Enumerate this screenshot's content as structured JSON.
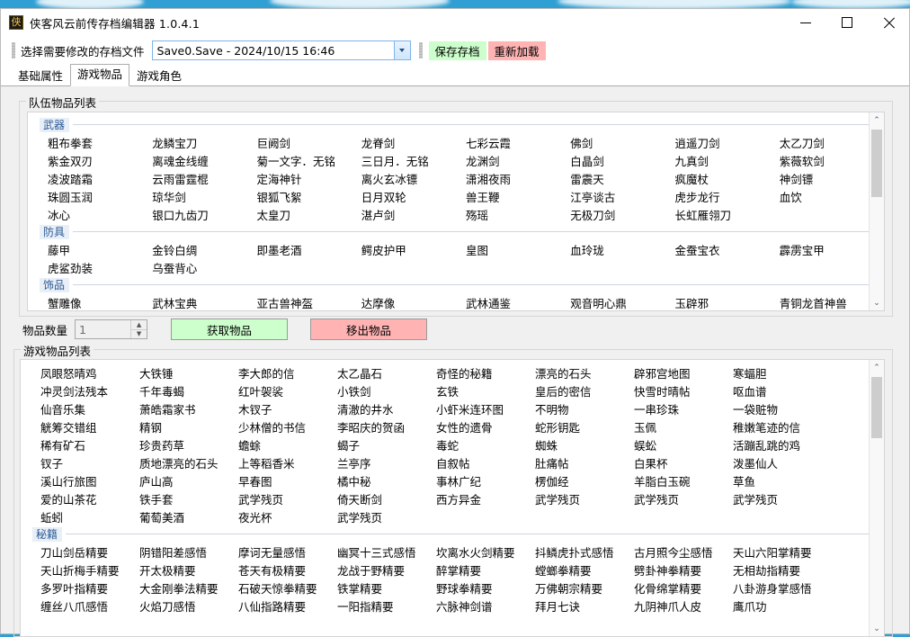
{
  "window": {
    "title": "侠客风云前传存档编辑器 1.0.4.1",
    "app_icon": "侠",
    "minimize_label": "minimize",
    "maximize_label": "maximize",
    "close_label": "close"
  },
  "filebar": {
    "label": "选择需要修改的存档文件",
    "combo_value": "Save0.Save - 2024/10/15 16:46",
    "save_button": "保存存档",
    "reload_button": "重新加载"
  },
  "tabs": [
    {
      "label": "基础属性",
      "active": false
    },
    {
      "label": "游戏物品",
      "active": true
    },
    {
      "label": "游戏角色",
      "active": false
    }
  ],
  "party_items": {
    "group_title": "队伍物品列表",
    "categories": [
      {
        "name": "武器",
        "rows": [
          [
            "粗布拳套",
            "龙鳞宝刀",
            "巨阙剑",
            "龙脊剑",
            "七彩云霞",
            "佛剑",
            "逍遥刀剑",
            "太乙刀剑"
          ],
          [
            "紫金双刃",
            "离魂金线缠",
            "菊一文字．无铭",
            "三日月．无铭",
            "龙渊剑",
            "白晶剑",
            "九真剑",
            "紫薇软剑"
          ],
          [
            "凌波踏霜",
            "云雨雷霆棍",
            "定海神针",
            "离火玄冰镖",
            "潇湘夜雨",
            "雷震天",
            "疯魔杖",
            "神剑镖"
          ],
          [
            "珠圆玉润",
            "琼华剑",
            "银狐飞絮",
            "日月双轮",
            "兽王鞭",
            "江亭谈古",
            "虎步龙行",
            "血饮"
          ],
          [
            "冰心",
            "银口九齿刀",
            "太皇刀",
            "湛卢剑",
            "殇瑶",
            "无极刀剑",
            "长虹雁翎刀",
            ""
          ]
        ]
      },
      {
        "name": "防具",
        "rows": [
          [
            "藤甲",
            "金铃白绸",
            "即墨老酒",
            "鳄皮护甲",
            "皇图",
            "血玲珑",
            "金蚕宝衣",
            "霹雳宝甲"
          ],
          [
            "虎鲨劲装",
            "乌蚕背心",
            "",
            "",
            "",
            "",
            "",
            ""
          ]
        ]
      },
      {
        "name": "饰品",
        "rows": [
          [
            "蟹雕像",
            "武林宝典",
            "亚古兽神盔",
            "达摩像",
            "武林通鉴",
            "观音明心鼎",
            "玉辟邪",
            "青铜龙首神兽"
          ]
        ]
      }
    ]
  },
  "controls": {
    "quantity_label": "物品数量",
    "quantity_value": "1",
    "get_item_button": "获取物品",
    "remove_item_button": "移出物品"
  },
  "game_items": {
    "group_title": "游戏物品列表",
    "rows": [
      [
        "凤眼怒晴鸡",
        "大铁锤",
        "李大郎的信",
        "太乙晶石",
        "奇怪的秘籍",
        "漂亮的石头",
        "辟邪宫地图",
        "寒蝠胆"
      ],
      [
        "冲灵剑法残本",
        "千年毒蝎",
        "红叶袈裟",
        "小铁剑",
        "玄铁",
        "皇后的密信",
        "快雪时晴帖",
        "呕血谱"
      ],
      [
        "仙音乐集",
        "萧皓霜家书",
        "木钗子",
        "清澈的井水",
        "小虾米连环图",
        "不明物",
        "一串珍珠",
        "一袋赃物"
      ],
      [
        "觥筹交错组",
        "精钢",
        "少林僧的书信",
        "李昭庆的贺函",
        "女性的遗骨",
        "蛇形钥匙",
        "玉佩",
        "稚嫩笔迹的信"
      ],
      [
        "稀有矿石",
        "珍贵药草",
        "蟾蜍",
        "蝎子",
        "毒蛇",
        "蜘蛛",
        "蜈蚣",
        "活蹦乱跳的鸡"
      ],
      [
        "钗子",
        "质地漂亮的石头",
        "上等稻香米",
        "兰亭序",
        "自叙帖",
        "肚痛帖",
        "白果杯",
        "泼墨仙人"
      ],
      [
        "溪山行旅图",
        "庐山高",
        "早春图",
        "橘中秘",
        "事林广纪",
        "楞伽经",
        "羊脂白玉碗",
        "草鱼"
      ],
      [
        "爱的山茶花",
        "铁手套",
        "武学残页",
        "倚天断剑",
        "西方异金",
        "武学残页",
        "武学残页",
        "武学残页"
      ],
      [
        "蚯蚓",
        "葡萄美酒",
        "夜光杯",
        "武学残页",
        "",
        "",
        "",
        ""
      ]
    ],
    "secret_manual": {
      "name": "秘籍",
      "rows": [
        [
          "刀山剑岳精要",
          "阴错阳差感悟",
          "摩诃无量感悟",
          "幽冥十三式感悟",
          "坎离水火剑精要",
          "抖鳞虎扑式感悟",
          "古月照今尘感悟",
          "天山六阳掌精要"
        ],
        [
          "天山折梅手精要",
          "开太极精要",
          "苍天有极精要",
          "龙战于野精要",
          "醉掌精要",
          "螳螂拳精要",
          "劈卦神拳精要",
          "无相劫指精要"
        ],
        [
          "多罗叶指精要",
          "大金刚拳法精要",
          "石破天惊拳精要",
          "铁掌精要",
          "野球拳精要",
          "万佛朝宗精要",
          "化骨绵掌精要",
          "八卦游身掌感悟"
        ],
        [
          "缠丝八爪感悟",
          "火焰刀感悟",
          "八仙指路精要",
          "一阳指精要",
          "六脉神剑谱",
          "拜月七诀",
          "九阴神爪人皮",
          "鹰爪功"
        ]
      ]
    }
  },
  "icons": {
    "scroll_up": "⌃",
    "scroll_down": "⌄"
  },
  "colors": {
    "save_green": "#ccffcc",
    "reload_red": "#ffb3b3",
    "category_blue": "#2b5b96",
    "window_bg": "#f0f0f0"
  }
}
